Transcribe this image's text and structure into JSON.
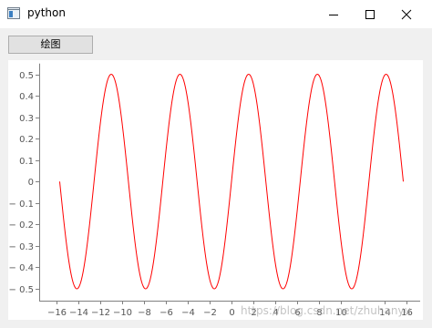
{
  "window": {
    "title": "python",
    "icons": {
      "app": "app-window-icon",
      "minimize": "minimize-icon",
      "maximize": "maximize-icon",
      "close": "close-icon"
    }
  },
  "toolbar": {
    "plot_label": "绘图"
  },
  "watermark": "https://blog.csdn.net/zhuhanyu",
  "colors": {
    "curve": "#ff0000",
    "axis": "#808080",
    "tick_text": "#555555"
  },
  "chart_data": {
    "type": "line",
    "title": "",
    "xlabel": "",
    "ylabel": "",
    "xlim": [
      -16,
      16
    ],
    "ylim": [
      -0.55,
      0.55
    ],
    "x_ticks": [
      -16,
      -14,
      -12,
      -10,
      -8,
      -6,
      -4,
      -2,
      0,
      2,
      4,
      6,
      8,
      10,
      14,
      16
    ],
    "x_tick_labels": [
      "−16",
      "−14",
      "−12",
      "−10",
      "−8",
      "−6",
      "−4",
      "−2",
      "0",
      "2",
      "4",
      "6",
      "8",
      "10",
      "14",
      "16"
    ],
    "y_ticks": [
      0.5,
      0.4,
      0.3,
      0.2,
      0.1,
      0,
      -0.1,
      -0.2,
      -0.3,
      -0.4,
      -0.5
    ],
    "y_tick_labels": [
      "0.5",
      "0.4",
      "0.3",
      "0.2",
      "0.1",
      "0",
      "− 0.1",
      "− 0.2",
      "− 0.3",
      "− 0.4",
      "− 0.5"
    ],
    "grid": false,
    "legend": "none",
    "series": [
      {
        "function": "0.5 * sin(x)",
        "x_range": [
          -5.0,
          5.0
        ],
        "x_scale": 3.14159,
        "x": [
          -15.71,
          -14.14,
          -12.57,
          -11.0,
          -9.42,
          -7.85,
          -6.28,
          -4.71,
          -3.14,
          -1.57,
          0.0,
          1.57,
          3.14,
          4.71,
          6.28,
          7.85,
          9.42,
          11.0,
          12.57,
          14.14,
          15.71
        ],
        "y": [
          0.0,
          -0.5,
          0.0,
          0.5,
          0.0,
          -0.5,
          0.0,
          0.5,
          0.0,
          -0.5,
          0.0,
          0.5,
          0.0,
          -0.5,
          0.0,
          0.5,
          0.0,
          -0.5,
          0.0,
          0.5,
          0.0
        ]
      }
    ]
  }
}
